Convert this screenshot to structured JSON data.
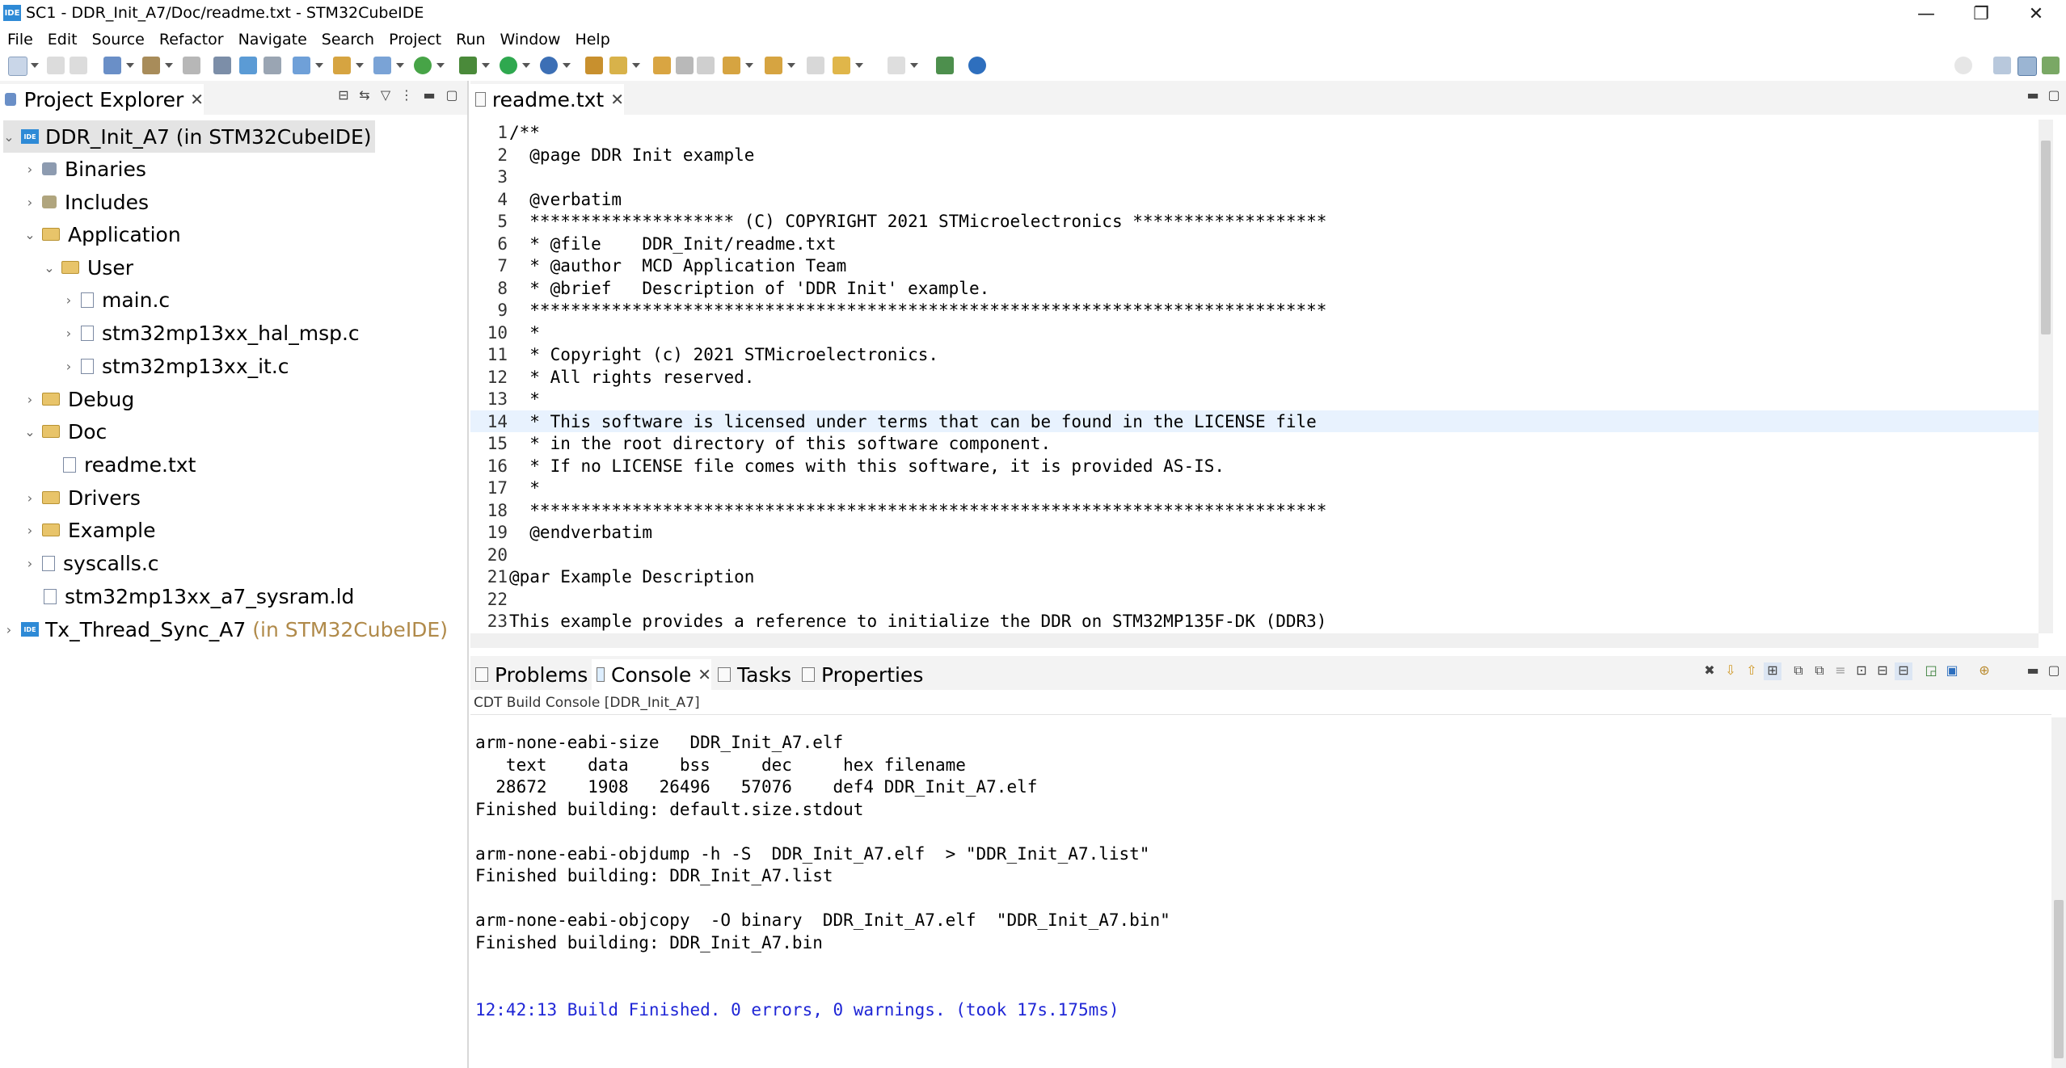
{
  "window": {
    "title": "SC1 - DDR_Init_A7/Doc/readme.txt - STM32CubeIDE",
    "logo": "IDE",
    "minimize": "—",
    "maximize": "❐",
    "close": "✕"
  },
  "menu": [
    "File",
    "Edit",
    "Source",
    "Refactor",
    "Navigate",
    "Search",
    "Project",
    "Run",
    "Window",
    "Help"
  ],
  "project_explorer": {
    "tab_label": "Project Explorer",
    "close": "✕",
    "items": [
      {
        "label": "DDR_Init_A7 (in STM32CubeIDE)",
        "suffix": ""
      },
      {
        "label": "Binaries"
      },
      {
        "label": "Includes"
      },
      {
        "label": "Application"
      },
      {
        "label": "User"
      },
      {
        "label": "main.c"
      },
      {
        "label": "stm32mp13xx_hal_msp.c"
      },
      {
        "label": "stm32mp13xx_it.c"
      },
      {
        "label": "Debug"
      },
      {
        "label": "Doc"
      },
      {
        "label": "readme.txt"
      },
      {
        "label": "Drivers"
      },
      {
        "label": "Example"
      },
      {
        "label": "syscalls.c"
      },
      {
        "label": "stm32mp13xx_a7_sysram.ld"
      },
      {
        "label": "Tx_Thread_Sync_A7",
        "suffix": "(in STM32CubeIDE)"
      }
    ]
  },
  "editor": {
    "tab_label": "readme.txt",
    "close": "✕",
    "lines": [
      {
        "n": "1",
        "text": "/**"
      },
      {
        "n": "2",
        "text": "  @page DDR Init example"
      },
      {
        "n": "3",
        "text": ""
      },
      {
        "n": "4",
        "text": "  @verbatim"
      },
      {
        "n": "5",
        "text": "  ******************** (C) COPYRIGHT 2021 STMicroelectronics *******************"
      },
      {
        "n": "6",
        "text": "  * @file    DDR_Init/readme.txt"
      },
      {
        "n": "7",
        "text": "  * @author  MCD Application Team"
      },
      {
        "n": "8",
        "text": "  * @brief   Description of 'DDR Init' example."
      },
      {
        "n": "9",
        "text": "  ******************************************************************************"
      },
      {
        "n": "10",
        "text": "  *"
      },
      {
        "n": "11",
        "text": "  * Copyright (c) 2021 STMicroelectronics."
      },
      {
        "n": "12",
        "text": "  * All rights reserved."
      },
      {
        "n": "13",
        "text": "  *"
      },
      {
        "n": "14",
        "text": "  * This software is licensed under terms that can be found in the LICENSE file"
      },
      {
        "n": "15",
        "text": "  * in the root directory of this software component."
      },
      {
        "n": "16",
        "text": "  * If no LICENSE file comes with this software, it is provided AS-IS."
      },
      {
        "n": "17",
        "text": "  *"
      },
      {
        "n": "18",
        "text": "  ******************************************************************************"
      },
      {
        "n": "19",
        "text": "  @endverbatim"
      },
      {
        "n": "20",
        "text": ""
      },
      {
        "n": "21",
        "text": "@par Example Description"
      },
      {
        "n": "22",
        "text": ""
      },
      {
        "n": "23",
        "text": "This example provides a reference to initialize the DDR on STM32MP135F-DK (DDR3)"
      }
    ]
  },
  "bottom": {
    "tabs": [
      {
        "label": "Problems"
      },
      {
        "label": "Console",
        "close": "✕"
      },
      {
        "label": "Tasks"
      },
      {
        "label": "Properties"
      }
    ],
    "console_title": "CDT Build Console [DDR_Init_A7]",
    "console_lines": [
      "arm-none-eabi-size   DDR_Init_A7.elf",
      "   text    data     bss     dec     hex filename",
      "  28672    1908   26496   57076    def4 DDR_Init_A7.elf",
      "Finished building: default.size.stdout",
      "",
      "arm-none-eabi-objdump -h -S  DDR_Init_A7.elf  > \"DDR_Init_A7.list\"",
      "Finished building: DDR_Init_A7.list",
      "",
      "arm-none-eabi-objcopy  -O binary  DDR_Init_A7.elf  \"DDR_Init_A7.bin\"",
      "Finished building: DDR_Init_A7.bin"
    ],
    "build_status": "12:42:13 Build Finished. 0 errors, 0 warnings. (took 17s.175ms)"
  },
  "colors": {
    "accent": "#2e8ad6",
    "console_status": "#1f26d6",
    "current_line": "#e8f2fe",
    "project_suffix": "#b08a4a"
  }
}
